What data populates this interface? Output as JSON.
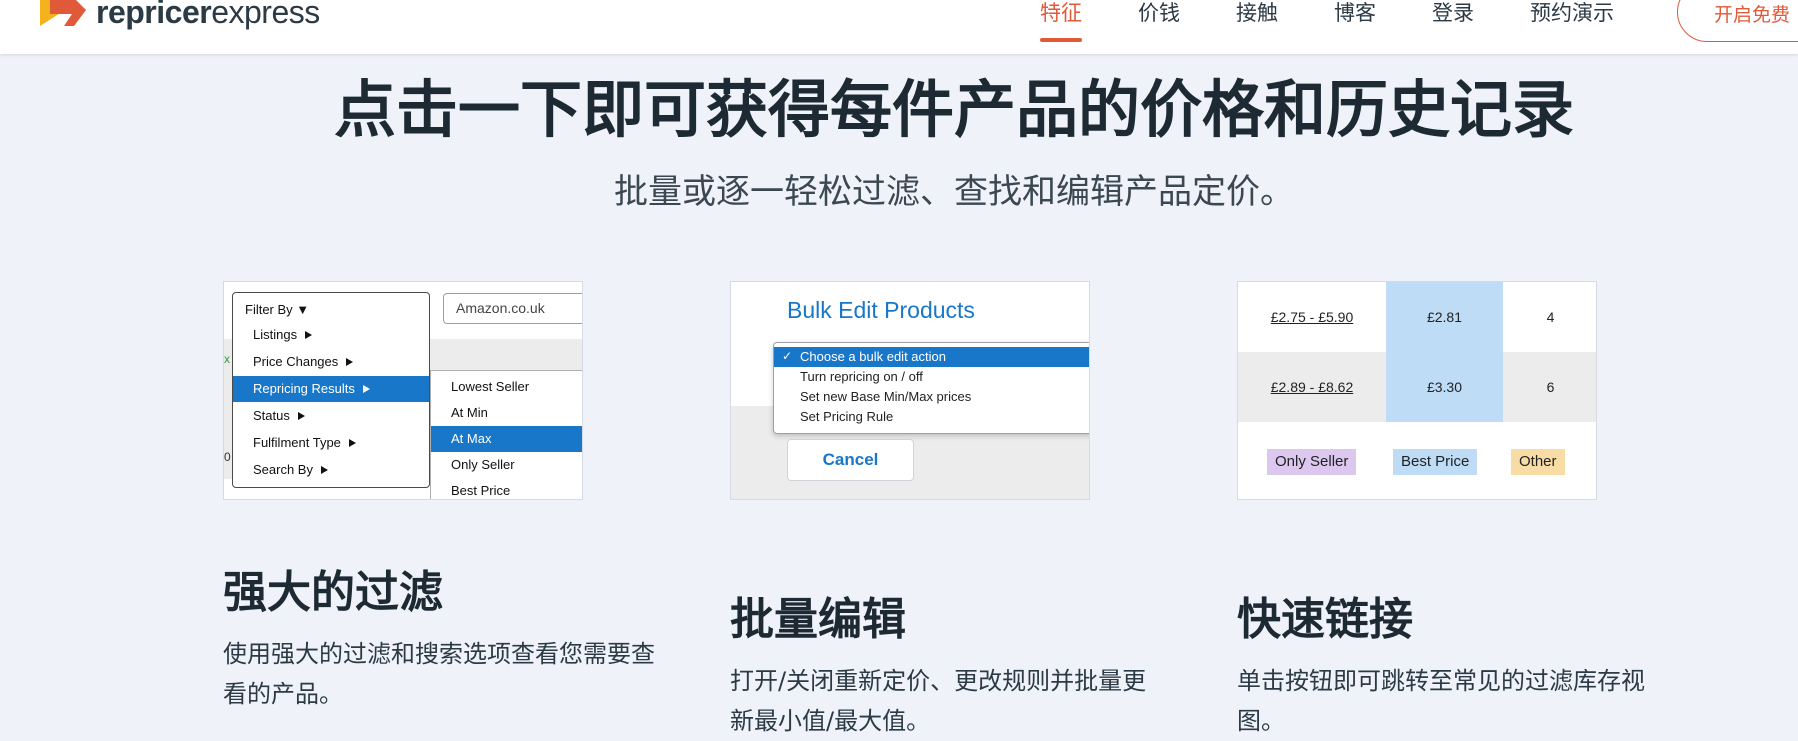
{
  "header": {
    "logo": {
      "bold": "repricer",
      "light": "express"
    },
    "nav": [
      "特征",
      "价钱",
      "接触",
      "博客",
      "登录",
      "预约演示"
    ],
    "active_nav": "特征",
    "cta_label": "开启免费",
    "accent_color": "#e05a3a"
  },
  "hero": {
    "title": "点击一下即可获得每件产品的价格和历史记录",
    "subtitle": "批量或逐一轻松过滤、查找和编辑产品定价。"
  },
  "filter_card": {
    "menu_title": "Filter By ▼",
    "items": [
      "Listings",
      "Price Changes",
      "Repricing Results",
      "Status",
      "Fulfilment Type",
      "Search By"
    ],
    "selected_item": "Repricing Results",
    "marketplace": "Amazon.co.uk",
    "submenu": [
      "Lowest Seller",
      "At Min",
      "At Max",
      "Only Seller",
      "Best Price"
    ],
    "selected_sub": "At Max",
    "edge_text_1": "x",
    "edge_text_2": "0"
  },
  "bulk_card": {
    "heading": "Bulk Edit Products",
    "options": [
      "Choose a bulk edit action",
      "Turn repricing on / off",
      "Set new Base Min/Max prices",
      "Set Pricing Rule"
    ],
    "check": "✓",
    "cancel_label": "Cancel"
  },
  "links_card": {
    "rows": [
      {
        "range": "£2.75 - £5.90",
        "price": "£2.81",
        "count": "4"
      },
      {
        "range": "£2.89 - £8.62",
        "price": "£3.30",
        "count": "6"
      }
    ],
    "badges": [
      {
        "label": "Only Seller",
        "color": "#dcc8ee"
      },
      {
        "label": "Best Price",
        "color": "#bfdcf7"
      },
      {
        "label": "Other",
        "color": "#f7dca6"
      }
    ]
  },
  "features": [
    {
      "title": "强大的过滤",
      "desc": "使用强大的过滤和搜索选项查看您需要查看的产品。"
    },
    {
      "title": "批量编辑",
      "desc": "打开/关闭重新定价、更改规则并批量更新最小值/最大值。"
    },
    {
      "title": "快速链接",
      "desc": "单击按钮即可跳转至常见的过滤库存视图。"
    }
  ]
}
